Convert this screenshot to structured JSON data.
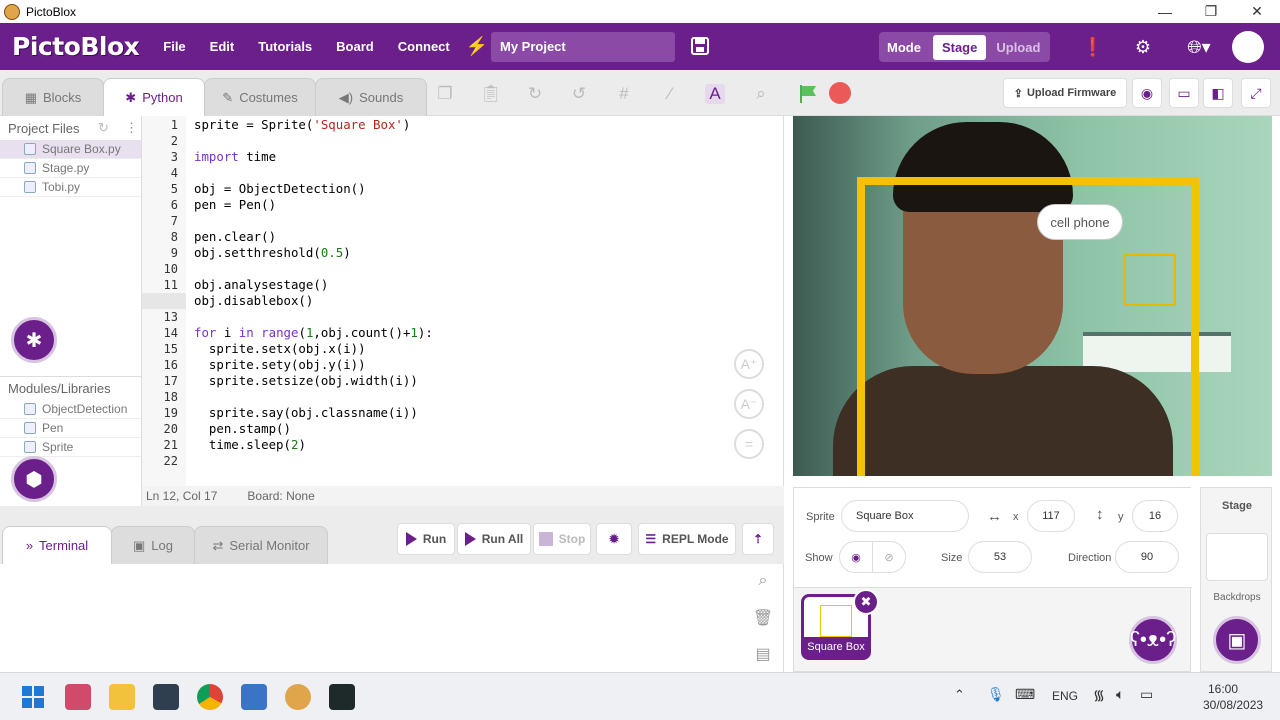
{
  "window": {
    "title": "PictoBlox",
    "minimize": "—",
    "restore": "❐",
    "close": "✕"
  },
  "menubar": {
    "logo": "PictoBlox",
    "items": [
      "File",
      "Edit",
      "Tutorials",
      "Board",
      "Connect"
    ],
    "project_name": "My Project",
    "mode_label": "Mode",
    "mode_stage": "Stage",
    "mode_upload": "Upload"
  },
  "tabs": {
    "blocks": "Blocks",
    "python": "Python",
    "costumes": "Costumes",
    "sounds": "Sounds"
  },
  "toolbar": {
    "upload_firmware": "Upload Firmware"
  },
  "files": {
    "header": "Project Files",
    "items": [
      "Square Box.py",
      "Stage.py",
      "Tobi.py"
    ],
    "modules_header": "Modules/Libraries",
    "modules": [
      "ObjectDetection",
      "Pen",
      "Sprite"
    ]
  },
  "editor": {
    "lines": [
      "1",
      "2",
      "3",
      "4",
      "5",
      "6",
      "7",
      "8",
      "9",
      "10",
      "11",
      "12",
      "13",
      "14",
      "15",
      "16",
      "17",
      "18",
      "19",
      "20",
      "21",
      "22"
    ],
    "code": [
      "sprite = Sprite('Square Box')",
      "",
      "import time",
      "",
      "obj = ObjectDetection()",
      "pen = Pen()",
      "",
      "pen.clear()",
      "obj.setthreshold(0.5)",
      "",
      "obj.analysestage()",
      "obj.disablebox()",
      "",
      "for i in range(1,obj.count()+1):",
      "  sprite.setx(obj.x(i))",
      "  sprite.sety(obj.y(i))",
      "  sprite.setsize(obj.width(i))",
      "",
      "  sprite.say(obj.classname(i))",
      "  pen.stamp()",
      "  time.sleep(2)",
      ""
    ],
    "status_pos": "Ln 12, Col 17",
    "status_board": "Board: None"
  },
  "console": {
    "tabs": [
      "Terminal",
      "Log",
      "Serial Monitor"
    ],
    "run": "Run",
    "run_all": "Run All",
    "stop": "Stop",
    "repl": "REPL Mode"
  },
  "stage": {
    "bubble_text": "cell phone"
  },
  "sprite_panel": {
    "sprite_label": "Sprite",
    "sprite_name": "Square Box",
    "x_label": "x",
    "x_value": "117",
    "y_label": "y",
    "y_value": "16",
    "show_label": "Show",
    "size_label": "Size",
    "size_value": "53",
    "direction_label": "Direction",
    "direction_value": "90",
    "thumb_caption": "Square Box"
  },
  "stage_panel": {
    "title": "Stage",
    "backdrops": "Backdrops"
  },
  "taskbar": {
    "lang": "ENG",
    "time": "16:00",
    "date": "30/08/2023"
  }
}
